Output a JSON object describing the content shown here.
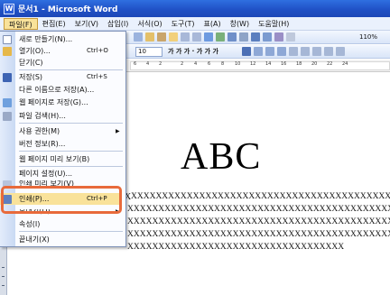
{
  "window": {
    "title": "문서1 - Microsoft Word",
    "icon_label": "W"
  },
  "menubar": {
    "items": [
      "파일(F)",
      "편집(E)",
      "보기(V)",
      "삽입(I)",
      "서식(O)",
      "도구(T)",
      "표(A)",
      "창(W)",
      "도움말(H)"
    ]
  },
  "toolbar": {
    "font_size": "10",
    "zoom": "110%",
    "formatting_marks": "가 가 가 · 가 가 가"
  },
  "ruler": {
    "numbers": [
      "6",
      "4",
      "2",
      "2",
      "4",
      "6",
      "8",
      "10",
      "12",
      "14",
      "16",
      "18",
      "20",
      "22",
      "24"
    ]
  },
  "file_menu": {
    "items": [
      {
        "label": "새로 만들기(N)...",
        "shortcut": "",
        "submenu": false,
        "icon": "new-document-icon"
      },
      {
        "label": "열기(O)...",
        "shortcut": "Ctrl+O",
        "submenu": false,
        "icon": "open-folder-icon"
      },
      {
        "label": "닫기(C)",
        "shortcut": "",
        "submenu": false,
        "icon": ""
      },
      {
        "label": "저장(S)",
        "shortcut": "Ctrl+S",
        "submenu": false,
        "icon": "save-icon"
      },
      {
        "label": "다른 이름으로 저장(A)...",
        "shortcut": "",
        "submenu": false,
        "icon": ""
      },
      {
        "label": "웹 페이지로 저장(G)...",
        "shortcut": "",
        "submenu": false,
        "icon": "web-page-icon"
      },
      {
        "label": "파일 검색(H)...",
        "shortcut": "",
        "submenu": false,
        "icon": "file-search-icon"
      },
      {
        "label": "사용 권한(M)",
        "shortcut": "",
        "submenu": true,
        "icon": ""
      },
      {
        "label": "버전 정보(R)...",
        "shortcut": "",
        "submenu": false,
        "icon": ""
      },
      {
        "label": "웹 페이지 미리 보기(B)",
        "shortcut": "",
        "submenu": false,
        "icon": ""
      },
      {
        "label": "페이지 설정(U)...",
        "shortcut": "",
        "submenu": false,
        "icon": ""
      },
      {
        "label": "인쇄 미리 보기(V)",
        "shortcut": "",
        "submenu": false,
        "icon": "print-preview-icon"
      },
      {
        "label": "인쇄(P)...",
        "shortcut": "Ctrl+P",
        "submenu": false,
        "icon": "print-icon"
      },
      {
        "label": "보내기(D)",
        "shortcut": "",
        "submenu": true,
        "icon": ""
      },
      {
        "label": "속성(I)",
        "shortcut": "",
        "submenu": false,
        "icon": ""
      },
      {
        "label": "끝내기(X)",
        "shortcut": "",
        "submenu": false,
        "icon": ""
      }
    ],
    "more_chevron": "︾"
  },
  "document": {
    "heading": "ABC",
    "mark": "X",
    "lines": [
      "XXXXXXXXXXXXXXXXXXXXXXXXXXXXXXXXXXXXXXXXXXXXX",
      "XXXXXXXXXXXXXXXXXXXXXXXXXXXXXXXXXXXXXXXXXXXXXXX",
      "XXXXXXXXXXXXXXXXXXXXXXXXXXXXXXXXXXXXXXXXXXXXXXX",
      "XXXXXXXXXXXXXXXXXXXXXXXXXXXXXXXXXXXXXXXXXXXXXXX",
      "XXXXXXXXXXXXXXXXXXXXXXXXXXXXXXXXXXX"
    ]
  },
  "colors": {
    "highlight_border": "#e86a3b",
    "title_bar": "#1f4fc4",
    "menu_highlight": "#f9e29a"
  }
}
